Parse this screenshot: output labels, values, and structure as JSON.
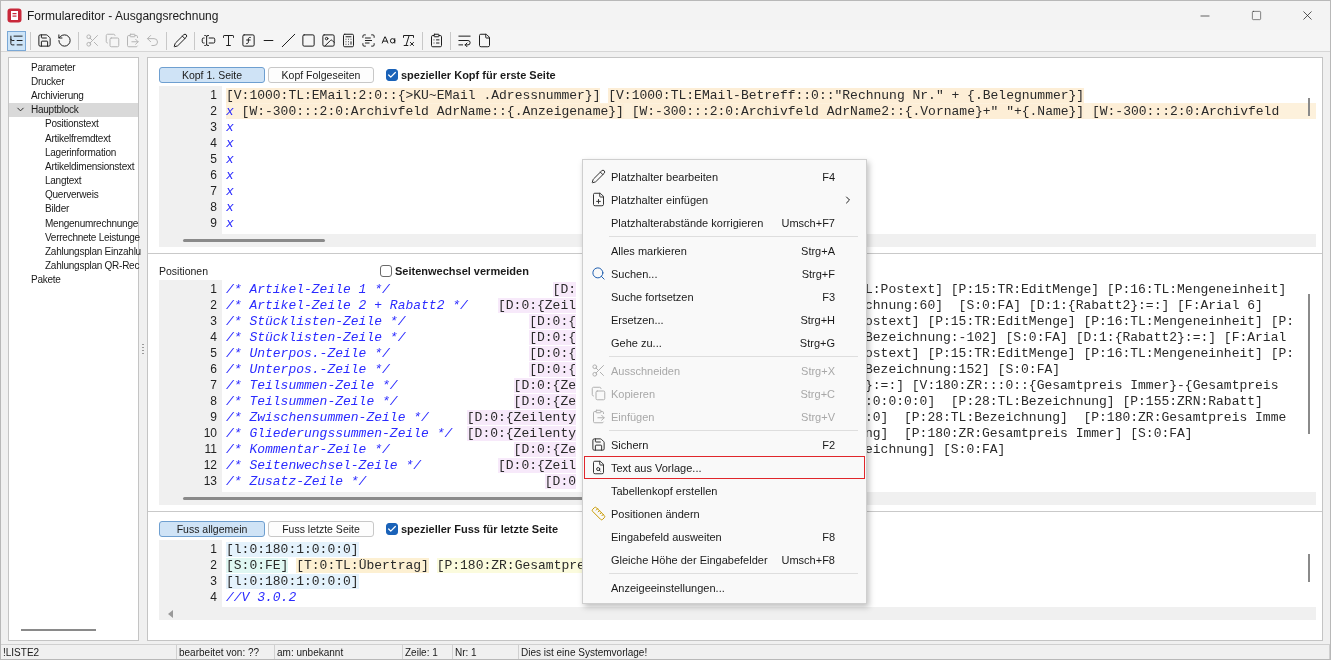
{
  "window": {
    "title": "Formulareditor - Ausgangsrechnung"
  },
  "toolbar": [
    [
      {
        "kind": "tree",
        "pressed": true,
        "disabled": false
      }
    ],
    [
      {
        "kind": "save",
        "pressed": false,
        "disabled": false
      },
      {
        "kind": "undo",
        "pressed": false,
        "disabled": false
      }
    ],
    [
      {
        "kind": "cut",
        "pressed": false,
        "disabled": true
      },
      {
        "kind": "copy",
        "pressed": false,
        "disabled": true
      },
      {
        "kind": "paste",
        "pressed": false,
        "disabled": true
      },
      {
        "kind": "revert",
        "pressed": false,
        "disabled": true
      }
    ],
    [
      {
        "kind": "pencil",
        "pressed": false,
        "disabled": false
      }
    ],
    [
      {
        "kind": "textfield",
        "pressed": false,
        "disabled": false
      },
      {
        "kind": "text",
        "pressed": false,
        "disabled": false
      },
      {
        "kind": "formula",
        "pressed": false,
        "disabled": false
      },
      {
        "kind": "hline",
        "pressed": false,
        "disabled": false
      },
      {
        "kind": "dline",
        "pressed": false,
        "disabled": false
      },
      {
        "kind": "rect",
        "pressed": false,
        "disabled": false
      },
      {
        "kind": "image",
        "pressed": false,
        "disabled": false
      },
      {
        "kind": "calc",
        "pressed": false,
        "disabled": false
      },
      {
        "kind": "field",
        "pressed": false,
        "disabled": false
      },
      {
        "kind": "font",
        "pressed": false,
        "disabled": false
      },
      {
        "kind": "clearformat",
        "pressed": false,
        "disabled": false
      }
    ],
    [
      {
        "kind": "user",
        "pressed": false,
        "disabled": false
      }
    ],
    [
      {
        "kind": "wrap",
        "pressed": false,
        "disabled": false
      },
      {
        "kind": "page",
        "pressed": false,
        "disabled": false
      }
    ]
  ],
  "sidebar": {
    "items": [
      {
        "label": "Parameter",
        "selected": false
      },
      {
        "label": "Drucker",
        "selected": false
      },
      {
        "label": "Archivierung",
        "selected": false
      },
      {
        "label": "Hauptblock",
        "selected": true,
        "expanded": true,
        "children": [
          {
            "label": "Positionstext",
            "selected": false
          },
          {
            "label": "Artikelfremdtext",
            "selected": false
          },
          {
            "label": "Lagerinformation",
            "selected": false
          },
          {
            "label": "Artikeldimensionstext",
            "selected": false
          },
          {
            "label": "Langtext",
            "selected": false
          },
          {
            "label": "Querverweis",
            "selected": false
          },
          {
            "label": "Bilder",
            "selected": false
          },
          {
            "label": "Mengenumrechnunge",
            "selected": false
          },
          {
            "label": "Verrechnete Leistunge",
            "selected": false
          },
          {
            "label": "Zahlungsplan Einzahlu",
            "selected": false
          },
          {
            "label": "Zahlungsplan QR-Rec",
            "selected": false
          }
        ]
      },
      {
        "label": "Pakete",
        "selected": false
      }
    ]
  },
  "header_section": {
    "tabs": [
      {
        "label": "Kopf 1. Seite",
        "selected": true
      },
      {
        "label": "Kopf Folgeseiten",
        "selected": false
      }
    ],
    "checkbox": {
      "label": "spezieller Kopf für erste Seite",
      "checked": true
    },
    "lines": [
      {
        "number": "1",
        "current": false,
        "segments": [
          {
            "text": "[V:1000:TL:EMail:2:0::{>KU~EMail .Adressnummer}]",
            "kind": "var"
          },
          {
            "text": "[V:1000:TL:EMail-Betreff::0::\"Rechnung Nr.\" + {.Belegnummer}]",
            "kind": "var"
          }
        ]
      },
      {
        "number": "2",
        "current": true,
        "segments": [
          {
            "text": "x",
            "kind": "comment"
          },
          {
            "text": "[W:-300:::2:0:Archivfeld AdrName::{.Anzeigename}]",
            "kind": "var"
          },
          {
            "text": "[W:-300:::2:0:Archivfeld AdrName2::{.Vorname}+\" \"+{.Name}]",
            "kind": "var"
          },
          {
            "text": "[W:-300:::2:0:Archivfeld",
            "kind": "var"
          }
        ]
      },
      {
        "number": "3",
        "current": false,
        "segments": [
          {
            "text": "x",
            "kind": "comment"
          }
        ]
      },
      {
        "number": "4",
        "current": false,
        "segments": [
          {
            "text": "x",
            "kind": "comment"
          }
        ]
      },
      {
        "number": "5",
        "current": false,
        "segments": [
          {
            "text": "x",
            "kind": "comment"
          }
        ]
      },
      {
        "number": "6",
        "current": false,
        "segments": [
          {
            "text": "x",
            "kind": "comment"
          }
        ]
      },
      {
        "number": "7",
        "current": false,
        "segments": [
          {
            "text": "x",
            "kind": "comment"
          }
        ]
      },
      {
        "number": "8",
        "current": false,
        "segments": [
          {
            "text": "x",
            "kind": "comment"
          }
        ]
      },
      {
        "number": "9",
        "current": false,
        "segments": [
          {
            "text": "x",
            "kind": "comment"
          }
        ]
      }
    ]
  },
  "positions_section": {
    "label": "Positionen",
    "checkbox": {
      "label": "Seitenwechsel vermeiden",
      "checked": false
    },
    "lines": [
      {
        "number": "1",
        "comment": "/* Artikel-Zeile 1 */",
        "left": "[D:",
        "right": "L:Postext] [P:15:TR:EditMenge] [P:16:TL:Mengeneinheit]"
      },
      {
        "number": "2",
        "comment": "/* Artikel-Zeile 2 + Rabatt2 */",
        "left": "[D:0:{Zeil",
        "right": "chnung:60]  [S:0:FA] [D:1:{Rabatt2}:=:] [F:Arial 6]"
      },
      {
        "number": "3",
        "comment": "/* Stücklisten-Zeile */",
        "left": "[D:0:{",
        "right": "ostext] [P:15:TR:EditMenge] [P:16:TL:Mengeneinheit] [P:"
      },
      {
        "number": "4",
        "comment": "/* Stücklisten-Zeile */",
        "left": "[D:0:{",
        "right": "Bezeichnung:-102] [S:0:FA] [D:1:{Rabatt2}:=:] [F:Arial"
      },
      {
        "number": "5",
        "comment": "/* Unterpos.-Zeile */",
        "left": "[D:0:{",
        "right": "ostext] [P:15:TR:EditMenge] [P:16:TL:Mengeneinheit] [P:"
      },
      {
        "number": "6",
        "comment": "/* Unterpos.-Zeile */",
        "left": "[D:0:{",
        "right": "Bezeichnung:152] [S:0:FA]"
      },
      {
        "number": "7",
        "comment": "/* Teilsummen-Zeile */",
        "left": "[D:0:{Ze",
        "right": "}:=:] [V:180:ZR:::0::{Gesamtpreis Immer}-{Gesamtpreis"
      },
      {
        "number": "8",
        "comment": "/* Teilsummen-Zeile */",
        "left": "[D:0:{Ze",
        "right": ":0:0:0:0]  [P:28:TL:Bezeichnung] [P:155:ZRN:Rabatt]"
      },
      {
        "number": "9",
        "comment": "/* Zwischensummen-Zeile */",
        "left": "[D:0:{Zeilenty",
        "right": ":0]  [P:28:TL:Bezeichnung]  [P:180:ZR:Gesamtpreis Imme"
      },
      {
        "number": "10",
        "comment": "/* Gliederungssummen-Zeile */",
        "left": "[D:0:{Zeilenty",
        "right": "ng]  [P:180:ZR:Gesamtpreis Immer] [S:0:FA]"
      },
      {
        "number": "11",
        "comment": "/* Kommentar-Zeile */",
        "left": "[D:0:{Ze",
        "right": "eichnung] [S:0:FA]"
      },
      {
        "number": "12",
        "comment": "/* Seitenwechsel-Zeile */",
        "left": "[D:0:{Zeil"
      },
      {
        "number": "13",
        "comment": "/* Zusatz-Zeile */",
        "left": "[D:0"
      }
    ]
  },
  "footer_section": {
    "tabs": [
      {
        "label": "Fuss allgemein",
        "selected": true
      },
      {
        "label": "Fuss letzte Seite",
        "selected": false
      }
    ],
    "checkbox": {
      "label": "spezieller Fuss für letzte Seite",
      "checked": true
    },
    "lines": [
      {
        "number": "1",
        "segments": [
          {
            "text": "[l:0:180:1:0:0:0]",
            "kind": "line"
          }
        ]
      },
      {
        "number": "2",
        "segments": [
          {
            "text": "[S:0:FE]",
            "kind": "style"
          },
          {
            "text": "[T:0:TL:Übertrag]",
            "kind": "text"
          },
          {
            "text": "[P:180:ZR:Gesamtpre",
            "kind": "pos"
          }
        ]
      },
      {
        "number": "3",
        "segments": [
          {
            "text": "[l:0:180:1:0:0:0]",
            "kind": "line"
          }
        ]
      },
      {
        "number": "4",
        "segments": [
          {
            "text": "//V 3.0.2",
            "kind": "comment"
          }
        ]
      }
    ]
  },
  "context_menu": {
    "groups": [
      [
        {
          "label": "Platzhalter bearbeiten",
          "shortcut": "F4",
          "kind": "edit",
          "disabled": false,
          "selected": false
        },
        {
          "label": "Platzhalter einfügen",
          "kind": "insert",
          "submenu": true,
          "disabled": false,
          "selected": false
        },
        {
          "label": "Platzhalterabstände korrigieren",
          "shortcut": "Umsch+F7",
          "kind": "plain",
          "disabled": false,
          "selected": false
        }
      ],
      [
        {
          "label": "Alles markieren",
          "shortcut": "Strg+A",
          "kind": "plain",
          "disabled": false,
          "selected": false
        },
        {
          "label": "Suchen...",
          "shortcut": "Strg+F",
          "kind": "search",
          "disabled": false,
          "selected": false
        },
        {
          "label": "Suche fortsetzen",
          "shortcut": "F3",
          "kind": "plain",
          "disabled": false,
          "selected": false
        },
        {
          "label": "Ersetzen...",
          "shortcut": "Strg+H",
          "kind": "plain",
          "disabled": false,
          "selected": false
        },
        {
          "label": "Gehe zu...",
          "shortcut": "Strg+G",
          "kind": "plain",
          "disabled": false,
          "selected": false
        }
      ],
      [
        {
          "label": "Ausschneiden",
          "shortcut": "Strg+X",
          "kind": "cut",
          "disabled": true,
          "selected": false
        },
        {
          "label": "Kopieren",
          "shortcut": "Strg+C",
          "kind": "copy",
          "disabled": true,
          "selected": false
        },
        {
          "label": "Einfügen",
          "shortcut": "Strg+V",
          "kind": "paste",
          "disabled": true,
          "selected": false
        }
      ],
      [
        {
          "label": "Sichern",
          "shortcut": "F2",
          "kind": "save",
          "disabled": false,
          "selected": false
        },
        {
          "label": "Text aus Vorlage...",
          "kind": "template",
          "disabled": false,
          "selected": true
        },
        {
          "label": "Tabellenkopf erstellen",
          "kind": "plain",
          "disabled": false,
          "selected": false
        },
        {
          "label": "Positionen ändern",
          "kind": "ruler",
          "disabled": false,
          "selected": false
        },
        {
          "label": "Eingabefeld ausweiten",
          "shortcut": "F8",
          "kind": "plain",
          "disabled": false,
          "selected": false
        },
        {
          "label": "Gleiche Höhe der Eingabefelder",
          "shortcut": "Umsch+F8",
          "kind": "plain",
          "disabled": false,
          "selected": false
        }
      ],
      [
        {
          "label": "Anzeigeeinstellungen...",
          "kind": "plain",
          "disabled": false,
          "selected": false
        }
      ]
    ]
  },
  "status_bar": [
    "!LISTE2",
    "bearbeitet von: ??",
    "am: unbekannt",
    "Zeile: 1",
    "Nr: 1",
    "Dies ist eine Systemvorlage!"
  ]
}
